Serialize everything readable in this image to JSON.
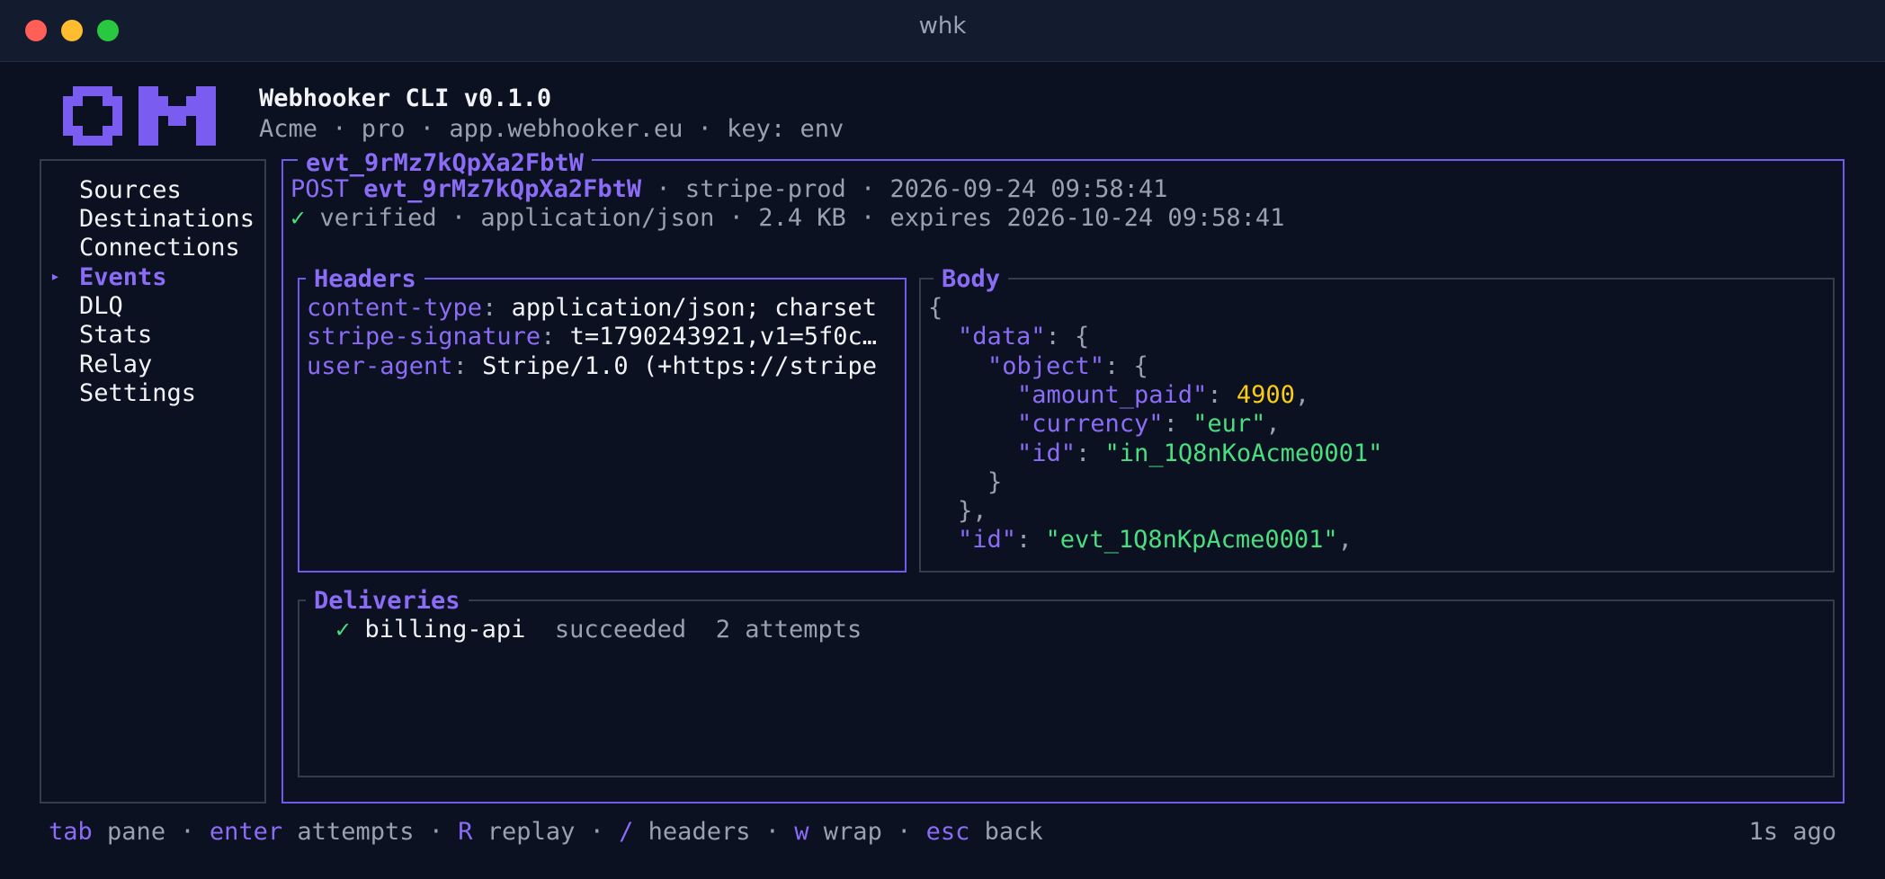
{
  "window": {
    "title": "whk"
  },
  "brand": {
    "title": "Webhooker CLI v0.1.0",
    "subtitle": "Acme · pro · app.webhooker.eu · key: env"
  },
  "sidebar": {
    "items": [
      {
        "label": "Sources"
      },
      {
        "label": "Destinations"
      },
      {
        "label": "Connections"
      },
      {
        "label": "Events",
        "active": true
      },
      {
        "label": "DLQ"
      },
      {
        "label": "Stats"
      },
      {
        "label": "Relay"
      },
      {
        "label": "Settings"
      }
    ],
    "active_marker": "▸"
  },
  "event": {
    "frame_title": "evt_9rMz7kQpXa2FbtW",
    "method": "POST",
    "id": "evt_9rMz7kQpXa2FbtW",
    "summary_rest": "· stripe-prod · 2026-09-24 09:58:41",
    "check": "✓",
    "status_line": "verified · application/json · 2.4 KB · expires 2026-10-24 09:58:41"
  },
  "headers_panel": {
    "title": "Headers",
    "rows": [
      {
        "key": "content-type",
        "value": "application/json; charset"
      },
      {
        "key": "stripe-signature",
        "value": "t=1790243921,v1=5f0c…"
      },
      {
        "key": "user-agent",
        "value": "Stripe/1.0 (+https://stripe"
      }
    ]
  },
  "body_panel": {
    "title": "Body",
    "lines": {
      "l1": "{",
      "l2_key": "\"data\"",
      "l2_rest": ": {",
      "l3_key": "\"object\"",
      "l3_rest": ": {",
      "l4_key": "\"amount_paid\"",
      "l4_sep": ": ",
      "l4_val": "4900",
      "l4_end": ",",
      "l5_key": "\"currency\"",
      "l5_sep": ": ",
      "l5_val": "\"eur\"",
      "l5_end": ",",
      "l6_key": "\"id\"",
      "l6_sep": ": ",
      "l6_val": "\"in_1Q8nKoAcme0001\"",
      "l7": "}",
      "l8": "},",
      "l9_key": "\"id\"",
      "l9_sep": ": ",
      "l9_val": "\"evt_1Q8nKpAcme0001\"",
      "l9_end": ","
    }
  },
  "deliveries_panel": {
    "title": "Deliveries",
    "rows": [
      {
        "check": "✓",
        "destination": "billing-api",
        "status": "succeeded",
        "attempts": "2 attempts"
      }
    ]
  },
  "footer": {
    "hints": [
      {
        "key": "tab",
        "label": "pane"
      },
      {
        "key": "enter",
        "label": "attempts"
      },
      {
        "key": "R",
        "label": "replay"
      },
      {
        "key": "/",
        "label": "headers"
      },
      {
        "key": "w",
        "label": "wrap"
      },
      {
        "key": "esc",
        "label": "back"
      }
    ],
    "separator": "·",
    "refreshed": "1s ago"
  },
  "colors": {
    "accent": "#8b6cf6",
    "background": "#0b1120",
    "success": "#4ade80",
    "number": "#facc15",
    "muted": "#9aa0ad"
  }
}
